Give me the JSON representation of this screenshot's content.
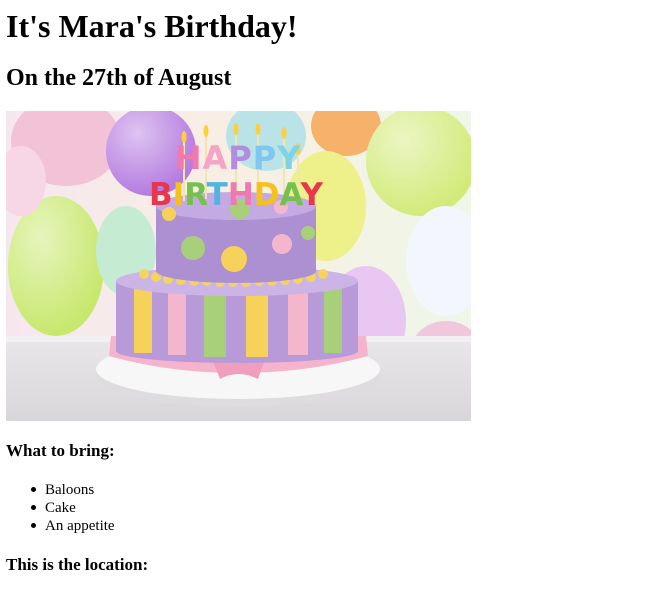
{
  "title": "It's Mara's Birthday!",
  "subtitle": "On the 27th of August",
  "image": {
    "subject": "birthday-cake-photo",
    "candle_letters": "HAPPY BIRTHDAY"
  },
  "bring_heading": "What to bring:",
  "bring_items": [
    "Baloons",
    "Cake",
    "An appetite"
  ],
  "location_heading": "This is the location:",
  "colors": {
    "cake_lavender": "#b89ad8",
    "cake_pink": "#f4b6cc",
    "cake_yellow": "#f6d25a",
    "cake_green": "#a8d07a",
    "balloon_green": "#d3ea7a",
    "balloon_purple": "#b57be0",
    "board": "#f4f4f4"
  }
}
